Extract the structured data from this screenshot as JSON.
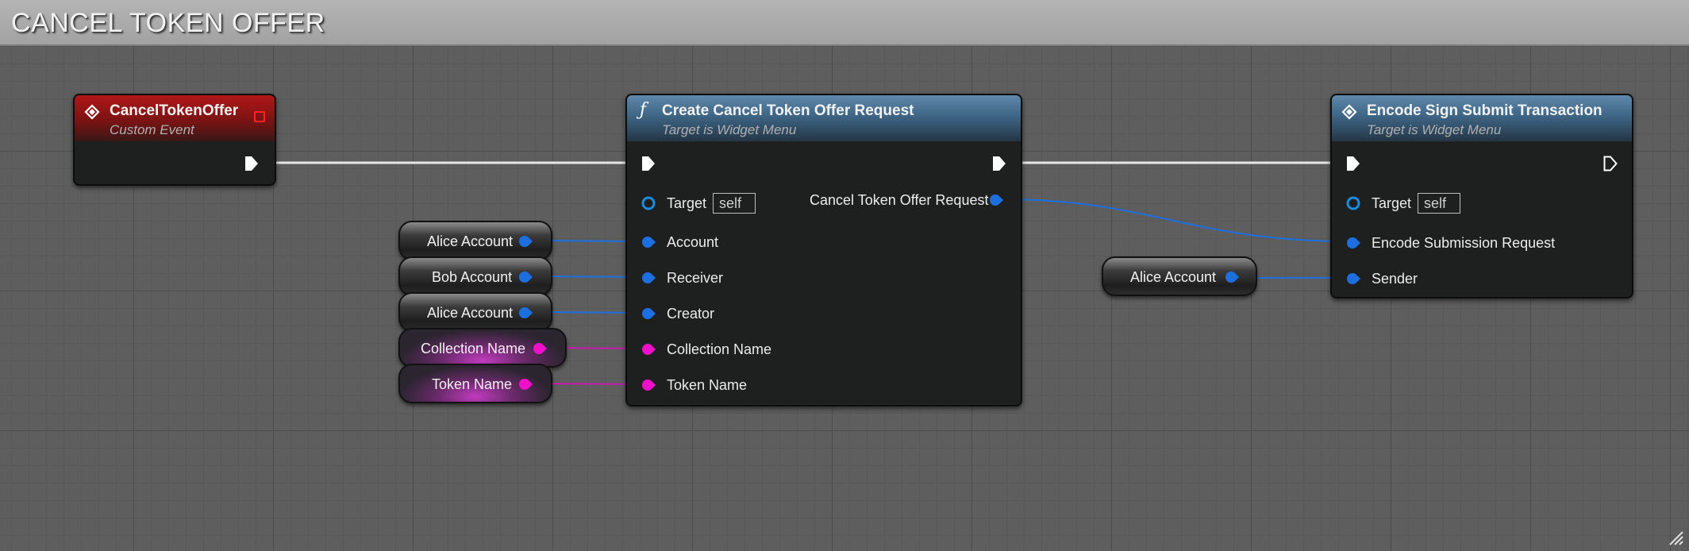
{
  "comment": {
    "title": "CANCEL TOKEN OFFER"
  },
  "colors": {
    "object_pin": "#1d6fe0",
    "string_pin": "#f20fcb",
    "exec": "#ffffff",
    "event_header": "#b11717",
    "function_header": "#3e6585"
  },
  "event_node": {
    "title": "CancelTokenOffer",
    "subtitle": "Custom Event",
    "icon": "event-diamond-icon"
  },
  "create_node": {
    "title": "Create Cancel Token Offer Request",
    "subtitle": "Target is Widget Menu",
    "icon": "function-icon",
    "target_label": "Target",
    "target_value": "self",
    "output_label": "Cancel Token Offer Request",
    "inputs": [
      "Account",
      "Receiver",
      "Creator",
      "Collection Name",
      "Token Name"
    ]
  },
  "submit_node": {
    "title": "Encode Sign Submit Transaction",
    "subtitle": "Target is Widget Menu",
    "icon": "event-diamond-icon",
    "target_label": "Target",
    "target_value": "self",
    "inputs": [
      "Encode Submission Request",
      "Sender"
    ]
  },
  "variables": [
    {
      "label": "Alice Account",
      "kind": "object"
    },
    {
      "label": "Bob Account",
      "kind": "object"
    },
    {
      "label": "Alice Account",
      "kind": "object"
    },
    {
      "label": "Collection Name",
      "kind": "string"
    },
    {
      "label": "Token Name",
      "kind": "string"
    },
    {
      "label": "Alice Account",
      "kind": "object"
    }
  ]
}
